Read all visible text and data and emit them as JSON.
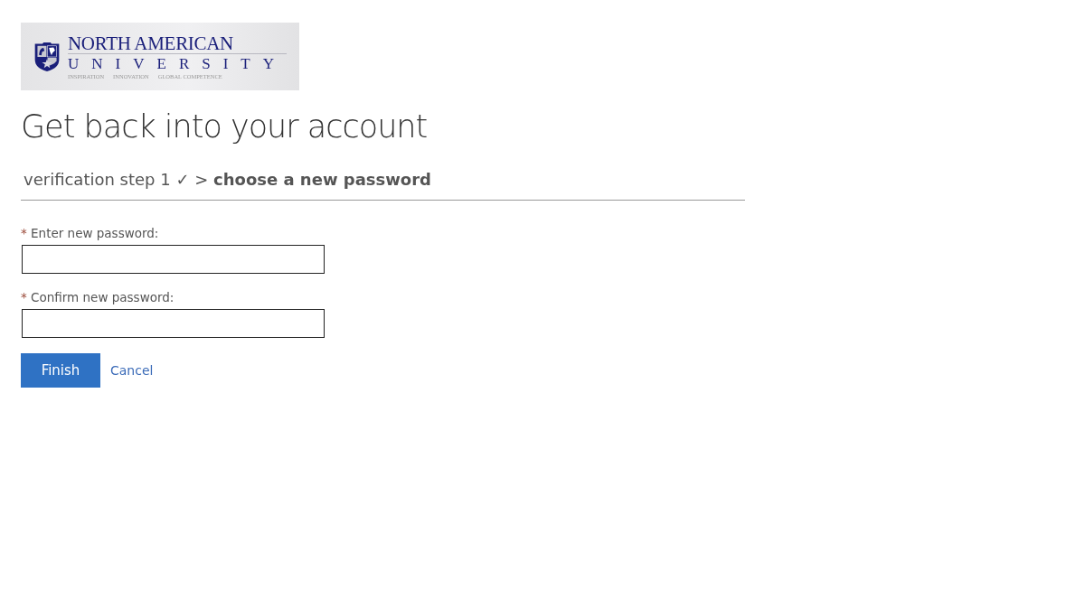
{
  "logo": {
    "name": "NORTH AMERICAN",
    "subname": "UNIVERSITY",
    "mottos": [
      "INSPIRATION",
      "INNOVATION",
      "GLOBAL COMPETENCE"
    ]
  },
  "title": "Get back into your account",
  "breadcrumb": "verification step 1 ✓ > **choose a new password**",
  "fields": [
    {
      "mark": "*",
      "label": "Enter new password:"
    },
    {
      "mark": "*",
      "label": "Confirm new password:"
    }
  ],
  "buttons": {
    "primary": "Finish",
    "link": "Cancel"
  }
}
